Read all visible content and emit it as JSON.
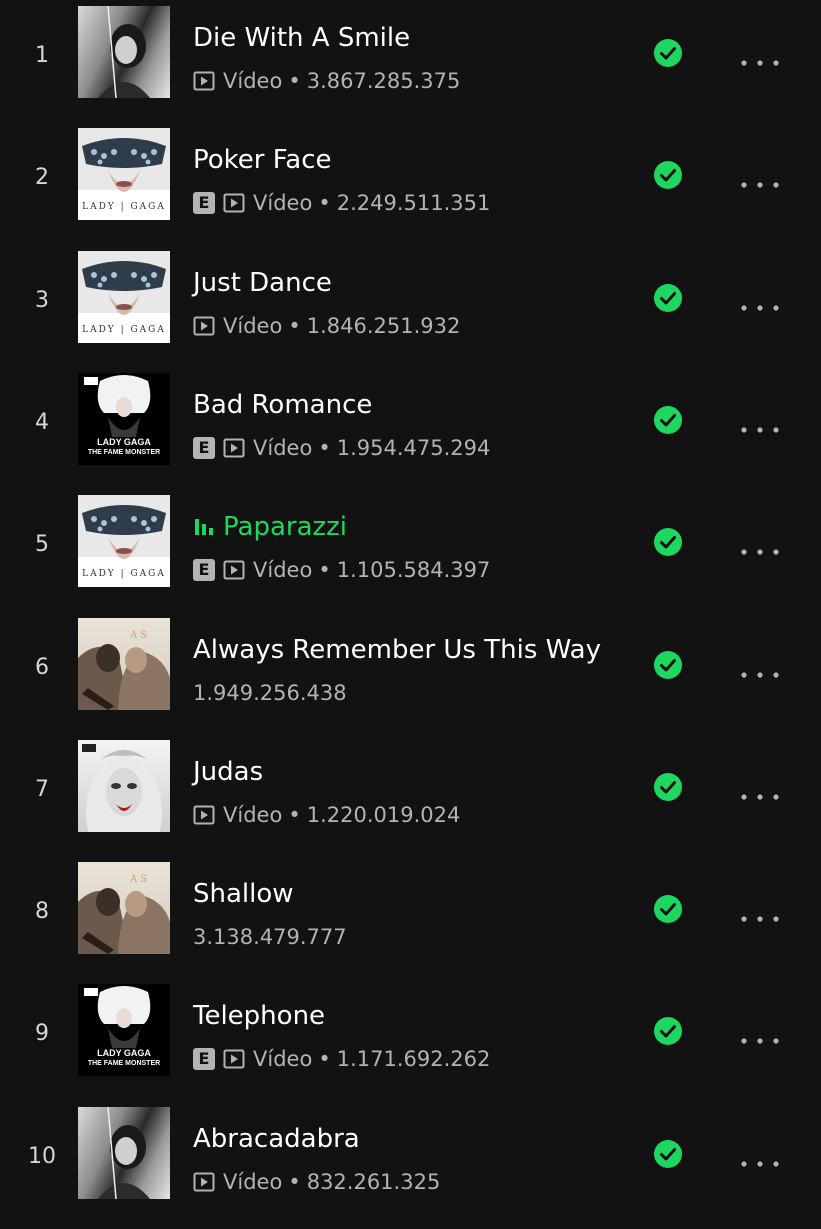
{
  "colors": {
    "background": "#121212",
    "accent": "#1ed760",
    "text_primary": "#ffffff",
    "text_secondary": "#b3b3b3"
  },
  "icons": {
    "video": "video-icon",
    "explicit": "explicit-badge",
    "saved": "check-circle-icon",
    "more": "more-options-icon",
    "now_playing": "equalizer-icon"
  },
  "explicit_label": "E",
  "video_label": "Vídeo",
  "separator": "•",
  "tracks": [
    {
      "rank": "1",
      "title": "Die With A Smile",
      "explicit": false,
      "video": true,
      "plays": "3.867.285.375",
      "playing": false,
      "cover": "mayhem"
    },
    {
      "rank": "2",
      "title": "Poker Face",
      "explicit": true,
      "video": true,
      "plays": "2.249.511.351",
      "playing": false,
      "cover": "fame"
    },
    {
      "rank": "3",
      "title": "Just Dance",
      "explicit": false,
      "video": true,
      "plays": "1.846.251.932",
      "playing": false,
      "cover": "fame"
    },
    {
      "rank": "4",
      "title": "Bad Romance",
      "explicit": true,
      "video": true,
      "plays": "1.954.475.294",
      "playing": false,
      "cover": "monster"
    },
    {
      "rank": "5",
      "title": "Paparazzi",
      "explicit": true,
      "video": true,
      "plays": "1.105.584.397",
      "playing": true,
      "cover": "fame"
    },
    {
      "rank": "6",
      "title": "Always Remember Us This Way",
      "explicit": false,
      "video": false,
      "plays": "1.949.256.438",
      "playing": false,
      "cover": "star"
    },
    {
      "rank": "7",
      "title": "Judas",
      "explicit": false,
      "video": true,
      "plays": "1.220.019.024",
      "playing": false,
      "cover": "btw"
    },
    {
      "rank": "8",
      "title": "Shallow",
      "explicit": false,
      "video": false,
      "plays": "3.138.479.777",
      "playing": false,
      "cover": "star"
    },
    {
      "rank": "9",
      "title": "Telephone",
      "explicit": true,
      "video": true,
      "plays": "1.171.692.262",
      "playing": false,
      "cover": "monster"
    },
    {
      "rank": "10",
      "title": "Abracadabra",
      "explicit": false,
      "video": true,
      "plays": "832.261.325",
      "playing": false,
      "cover": "mayhem"
    }
  ],
  "cover_art_text": {
    "fame": "LADY|GAGA",
    "monster_line1": "LADY GAGA",
    "monster_line2": "THE FAME MONSTER"
  }
}
